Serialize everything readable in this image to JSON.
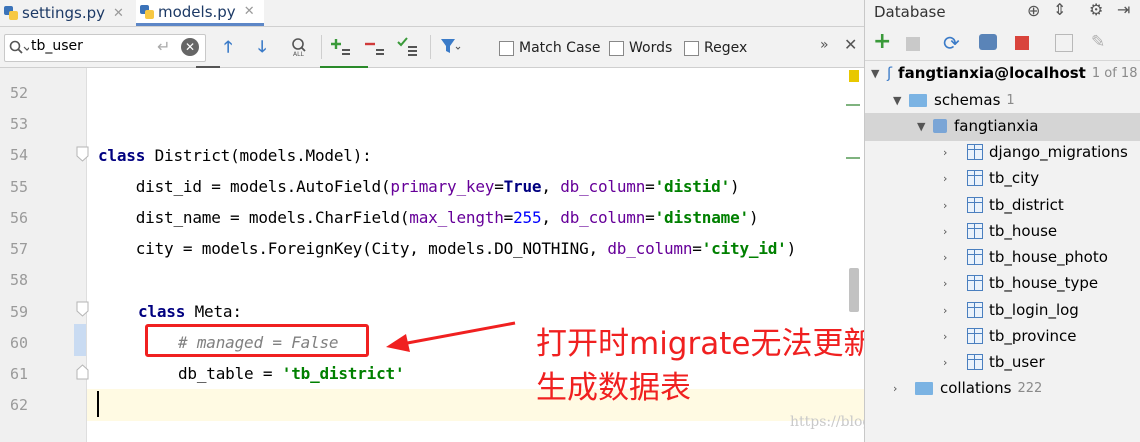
{
  "tabs": [
    {
      "label": "settings.py"
    },
    {
      "label": "models.py"
    }
  ],
  "find": {
    "query": "tb_user",
    "match_case": "Match Case",
    "words": "Words",
    "regex": "Regex"
  },
  "editor": {
    "line_numbers": [
      "52",
      "53",
      "54",
      "55",
      "56",
      "57",
      "58",
      "59",
      "60",
      "61",
      "62"
    ],
    "line54": {
      "kw": "class",
      "rest": " District(models.Model):"
    },
    "line55": {
      "a": "    dist_id = models.AutoField(",
      "p1": "primary_key",
      "eq1": "=",
      "v1": "True",
      "sep": ", ",
      "p2": "db_column",
      "eq2": "=",
      "v2": "'distid'",
      "end": ")"
    },
    "line56": {
      "a": "    dist_name = models.CharField(",
      "p1": "max_length",
      "eq1": "=",
      "v1": "255",
      "sep": ", ",
      "p2": "db_column",
      "eq2": "=",
      "v2": "'distname'",
      "end": ")"
    },
    "line57": {
      "a": "    city = models.ForeignKey(City, models.DO_NOTHING, ",
      "p2": "db_column",
      "eq2": "=",
      "v2": "'city_id'",
      "end": ")"
    },
    "line59": {
      "kw": "class",
      "rest": " Meta:"
    },
    "line60": {
      "comment": "# managed = False"
    },
    "line61": {
      "a": "db_table = ",
      "v": "'tb_district'"
    }
  },
  "annotation": {
    "line1": "打开时migrate无法更新同步",
    "line2": "生成数据表"
  },
  "watermark": "https://blog.csdn.net/Dorisi_H_n_q",
  "db_panel": {
    "title": "Database",
    "datasource": {
      "name": "fangtianxia@localhost",
      "count": "1 of 18"
    },
    "schemas": {
      "label": "schemas",
      "count": "1"
    },
    "schema": "fangtianxia",
    "tables": [
      "django_migrations",
      "tb_city",
      "tb_district",
      "tb_house",
      "tb_house_photo",
      "tb_house_type",
      "tb_login_log",
      "tb_province",
      "tb_user"
    ],
    "collations": {
      "label": "collations",
      "count": "222"
    }
  }
}
